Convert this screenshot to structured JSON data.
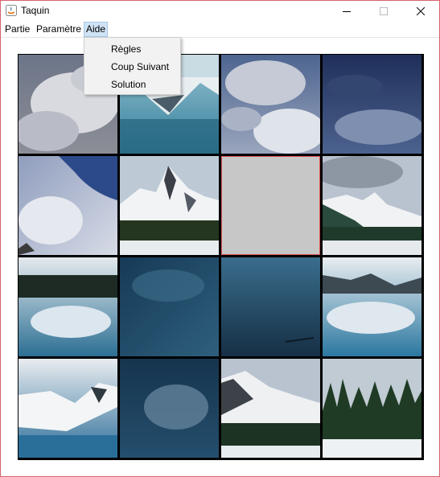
{
  "window": {
    "title": "Taquin"
  },
  "menubar": {
    "items": [
      {
        "label": "Partie"
      },
      {
        "label": "Paramètre"
      },
      {
        "label": "Aide"
      }
    ]
  },
  "aide_menu": {
    "items": [
      {
        "label": "Règles"
      },
      {
        "label": "Coup Suivant"
      },
      {
        "label": "Solution"
      }
    ]
  },
  "board": {
    "rows": 4,
    "cols": 4,
    "empty_tile": {
      "row": 2,
      "col": 3
    },
    "empty_color": "#c7c7c7",
    "highlight_color": "#e05050"
  },
  "colors": {
    "window_border": "#d9616f",
    "menu_highlight": "#cfe3f5"
  }
}
